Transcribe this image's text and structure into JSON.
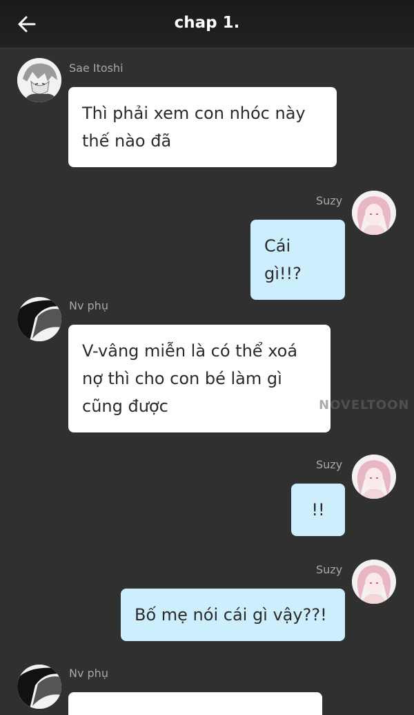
{
  "header": {
    "title": "chap 1.",
    "back_icon": "arrow-left-icon"
  },
  "messages": [
    {
      "sender": "Sae Itoshi",
      "side": "left",
      "avatar": "sae-itoshi-avatar",
      "text": "Thì phải xem con nhóc này thế nào đã"
    },
    {
      "sender": "Suzy",
      "side": "right",
      "avatar": "suzy-avatar",
      "text": "Cái gì!!?"
    },
    {
      "sender": "Nv phụ",
      "side": "left",
      "avatar": "nv-phu-avatar",
      "text": "V-vâng miễn là có thể xoá nợ thì cho con bé làm gì cũng được"
    },
    {
      "sender": "Suzy",
      "side": "right",
      "avatar": "suzy-avatar",
      "text": "!!"
    },
    {
      "sender": "Suzy",
      "side": "right",
      "avatar": "suzy-avatar",
      "text": "Bố mẹ nói cái gì vậy??!"
    },
    {
      "sender": "Nv phụ",
      "side": "left",
      "avatar": "nv-phu-avatar",
      "text": ""
    }
  ],
  "watermark": "NOVELTOON",
  "colors": {
    "background": "#303030",
    "header": "#1f1f1f",
    "left_bubble": "#ffffff",
    "right_bubble": "#cdeefd",
    "sender_text": "#a8a8a8"
  }
}
